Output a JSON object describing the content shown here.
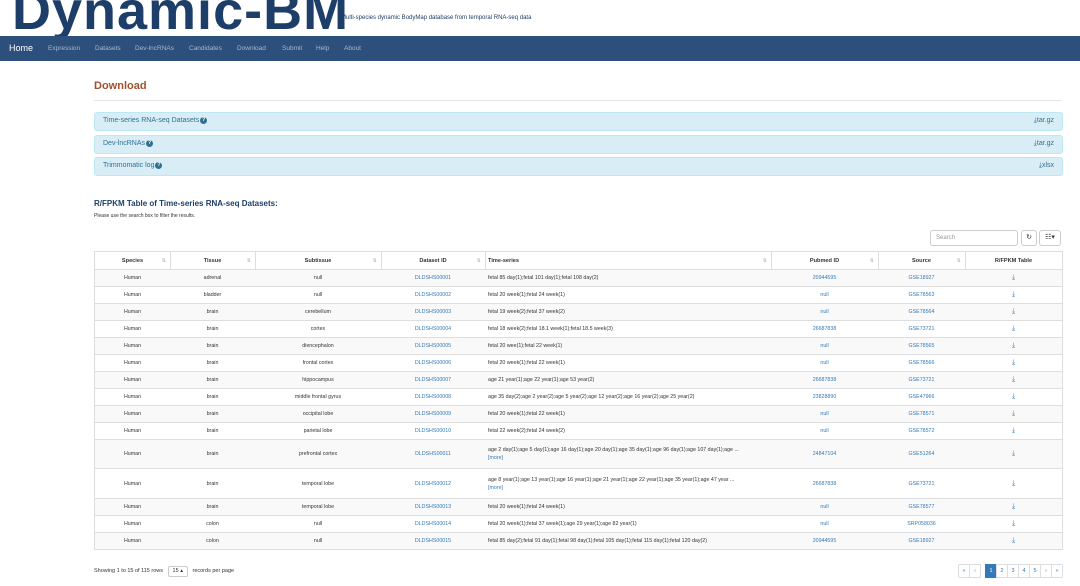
{
  "header": {
    "logo_text": "Dynamic-BM",
    "tagline": "Multi-species dynamic BodyMap database from temporal RNA-seq data"
  },
  "nav": {
    "items": [
      {
        "label": "Home",
        "active": true
      },
      {
        "label": "Expression"
      },
      {
        "label": "Datasets"
      },
      {
        "label": "Dev-lncRNAs"
      },
      {
        "label": "Candidates"
      },
      {
        "label": "Download"
      },
      {
        "label": "Submit"
      },
      {
        "label": "Help"
      },
      {
        "label": "About"
      }
    ]
  },
  "page": {
    "title": "Download"
  },
  "downloads": [
    {
      "name": "Time-series RNA-seq Datasets",
      "link": "tar.gz"
    },
    {
      "name": "Dev-lncRNAs",
      "link": "tar.gz"
    },
    {
      "name": "Trimmomatic log",
      "link": "xlsx"
    }
  ],
  "table_section": {
    "title": "R/FPKM Table of Time-series RNA-seq Datasets:",
    "hint": "Please use the search box to filter the results.",
    "search_placeholder": "Search",
    "refresh_icon": "refresh-icon",
    "columns_icon": "columns-icon"
  },
  "table": {
    "headers": [
      "Species",
      "Tissue",
      "Subtissue",
      "Dataset ID",
      "Time-series",
      "Pubmed ID",
      "Source",
      "R/FPKM Table"
    ],
    "rows": [
      {
        "species": "Human",
        "tissue": "adrenal",
        "subtissue": "null",
        "dataset_id": "DLDSHS00001",
        "time_series": "fetal 85 day(1);fetal 101 day(1);fetal 108 day(2)",
        "more": "",
        "pubmed": "20944595",
        "source": "GSE18927"
      },
      {
        "species": "Human",
        "tissue": "bladder",
        "subtissue": "null",
        "dataset_id": "DLDSHS00002",
        "time_series": "fetal 20 week(1);fetal 24 week(1)",
        "more": "",
        "pubmed": "null",
        "source": "GSE78563"
      },
      {
        "species": "Human",
        "tissue": "brain",
        "subtissue": "cerebellum",
        "dataset_id": "DLDSHS00003",
        "time_series": "fetal 19 week(2);fetal 37 week(2)",
        "more": "",
        "pubmed": "null",
        "source": "GSE78564"
      },
      {
        "species": "Human",
        "tissue": "brain",
        "subtissue": "cortex",
        "dataset_id": "DLDSHS00004",
        "time_series": "fetal 18 week(2);fetal 18.1 week(1);fetal 18.5 week(3)",
        "more": "",
        "pubmed": "26687838",
        "source": "GSE73721"
      },
      {
        "species": "Human",
        "tissue": "brain",
        "subtissue": "diencephalon",
        "dataset_id": "DLDSHS00005",
        "time_series": "fetal 20 wee(1);fetal 22 week(1)",
        "more": "",
        "pubmed": "null",
        "source": "GSE78565"
      },
      {
        "species": "Human",
        "tissue": "brain",
        "subtissue": "frontal cortex",
        "dataset_id": "DLDSHS00006",
        "time_series": "fetal 20 week(1);fetal 22 week(1)",
        "more": "",
        "pubmed": "null",
        "source": "GSE78566"
      },
      {
        "species": "Human",
        "tissue": "brain",
        "subtissue": "hippocampus",
        "dataset_id": "DLDSHS00007",
        "time_series": "age 21 year(1);age 22 year(1);age 53 year(2)",
        "more": "",
        "pubmed": "26687838",
        "source": "GSE73721"
      },
      {
        "species": "Human",
        "tissue": "brain",
        "subtissue": "middle frontal gyrus",
        "dataset_id": "DLDSHS00008",
        "time_series": "age 35 day(2);age 2 year(2);age 5 year(2);age 12 year(2);age 16 year(2);age 25 year(2)",
        "more": "",
        "pubmed": "23828890",
        "source": "GSE47966"
      },
      {
        "species": "Human",
        "tissue": "brain",
        "subtissue": "occipital lobe",
        "dataset_id": "DLDSHS00009",
        "time_series": "fetal 20 week(1);fetal 22 week(1)",
        "more": "",
        "pubmed": "null",
        "source": "GSE78571"
      },
      {
        "species": "Human",
        "tissue": "brain",
        "subtissue": "parietal lobe",
        "dataset_id": "DLDSHS00010",
        "time_series": "fetal 22 week(2);fetal 24 week(2)",
        "more": "",
        "pubmed": "null",
        "source": "GSE78572"
      },
      {
        "species": "Human",
        "tissue": "brain",
        "subtissue": "prefrontal cortex",
        "dataset_id": "DLDSHS00011",
        "time_series": "age 2 day(1);age 5 day(1);age 16 day(1);age 20 day(1);age 35 day(1);age 96 day(1);age 107 day(1);age ...",
        "more": "[more]",
        "pubmed": "24847104",
        "source": "GSE51264"
      },
      {
        "species": "Human",
        "tissue": "brain",
        "subtissue": "temporal lobe",
        "dataset_id": "DLDSHS00012",
        "time_series": "age 8 year(1);age 13 year(1);age 16 year(1);age 21 year(1);age 22 year(1);age 35 year(1);age 47 year ...",
        "more": "[more]",
        "pubmed": "26687838",
        "source": "GSE73721"
      },
      {
        "species": "Human",
        "tissue": "brain",
        "subtissue": "temporal lobe",
        "dataset_id": "DLDSHS00013",
        "time_series": "fetal 20 week(1);fetal 24 week(1)",
        "more": "",
        "pubmed": "null",
        "source": "GSE78577"
      },
      {
        "species": "Human",
        "tissue": "colon",
        "subtissue": "null",
        "dataset_id": "DLDSHS00014",
        "time_series": "fetal 20 week(1);fetal 37 week(1);age 29 year(1);age 82 year(1)",
        "more": "",
        "pubmed": "null",
        "source": "SRP058036"
      },
      {
        "species": "Human",
        "tissue": "colon",
        "subtissue": "null",
        "dataset_id": "DLDSHS00015",
        "time_series": "fetal 85 day(2);fetal 91 day(1);fetal 98 day(1);fetal 105 day(1);fetal 115 day(1);fetal 120 day(2)",
        "more": "",
        "pubmed": "20944595",
        "source": "GSE18927"
      }
    ]
  },
  "footer": {
    "showing": "Showing 1 to 15 of 115 rows",
    "per_page_value": "15",
    "per_page_suffix": "records per page"
  },
  "pagination": {
    "prev_first": "«",
    "prev": "‹",
    "pages": [
      "1",
      "2",
      "3",
      "4",
      "5"
    ],
    "active": "1",
    "next": "›",
    "next_last": "»"
  }
}
